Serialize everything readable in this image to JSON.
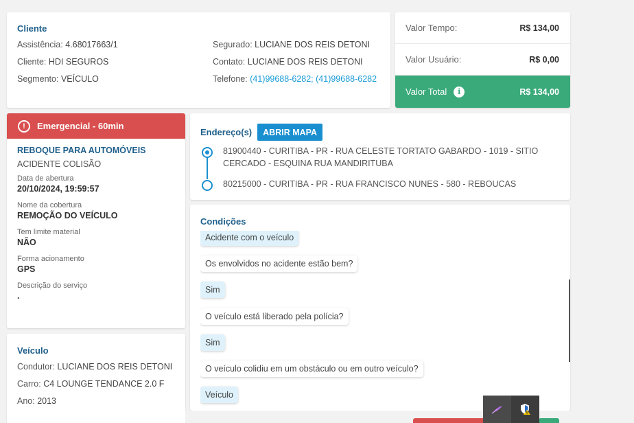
{
  "cliente": {
    "title": "Cliente",
    "assistencia_label": "Assistência:",
    "assistencia": "4.68017663/1",
    "cliente_label": "Cliente:",
    "cliente": "HDI SEGUROS",
    "segmento_label": "Segmento:",
    "segmento": "VEÍCULO",
    "segurado_label": "Segurado:",
    "segurado": "LUCIANE DOS REIS DETONI",
    "contato_label": "Contato:",
    "contato": "LUCIANE DOS REIS DETONI",
    "telefone_label": "Telefone:",
    "telefone": "(41)99688-6282; (41)99688-6282"
  },
  "valores": {
    "tempo_label": "Valor Tempo:",
    "tempo": "R$ 134,00",
    "usuario_label": "Valor Usuário:",
    "usuario": "R$ 0,00",
    "total_label": "Valor Total",
    "total": "R$ 134,00",
    "total_color": "#3aaa7a"
  },
  "servico": {
    "badge": "Emergencial - 60min",
    "badge_color": "#d94f4f",
    "title": "REBOQUE PARA AUTOMÓVEIS",
    "subtitle": "ACIDENTE COLISÃO",
    "fields": [
      {
        "label": "Data de abertura",
        "value": "20/10/2024, 19:59:57"
      },
      {
        "label": "Nome da cobertura",
        "value": "REMOÇÃO DO VEÍCULO"
      },
      {
        "label": "Tem limite material",
        "value": "NÃO"
      },
      {
        "label": "Forma acionamento",
        "value": "GPS"
      },
      {
        "label": "Descrição do serviço",
        "value": "."
      }
    ]
  },
  "veiculo": {
    "title": "Veículo",
    "condutor_label": "Condutor:",
    "condutor": "LUCIANE DOS REIS DETONI",
    "carro_label": "Carro:",
    "carro": "C4 LOUNGE TENDANCE 2.0 F",
    "ano_label": "Ano:",
    "ano": "2013"
  },
  "endereco": {
    "title": "Endereço(s)",
    "map_button": "ABRIR MAPA",
    "addresses": [
      "81900440 - CURITIBA - PR - RUA CELESTE TORTATO GABARDO - 1019 - SITIO CERCADO - ESQUINA RUA MANDIRITUBA",
      "80215000 - CURITIBA - PR - RUA FRANCISCO NUNES - 580 - REBOUCAS"
    ]
  },
  "condicoes": {
    "title": "Condições",
    "messages": [
      {
        "type": "answer",
        "text": "Acidente com o veículo"
      },
      {
        "type": "question",
        "text": "Os envolvidos no acidente estão bem?"
      },
      {
        "type": "answer",
        "text": "Sim"
      },
      {
        "type": "question",
        "text": "O veículo está liberado pela polícia?"
      },
      {
        "type": "answer",
        "text": "Sim"
      },
      {
        "type": "question",
        "text": "O veículo colidiu em um obstáculo ou em outro veículo?"
      },
      {
        "type": "answer",
        "text": "Veículo"
      }
    ]
  },
  "tray": {
    "icons": [
      "feather-pen-icon",
      "shield-warning-icon"
    ]
  }
}
